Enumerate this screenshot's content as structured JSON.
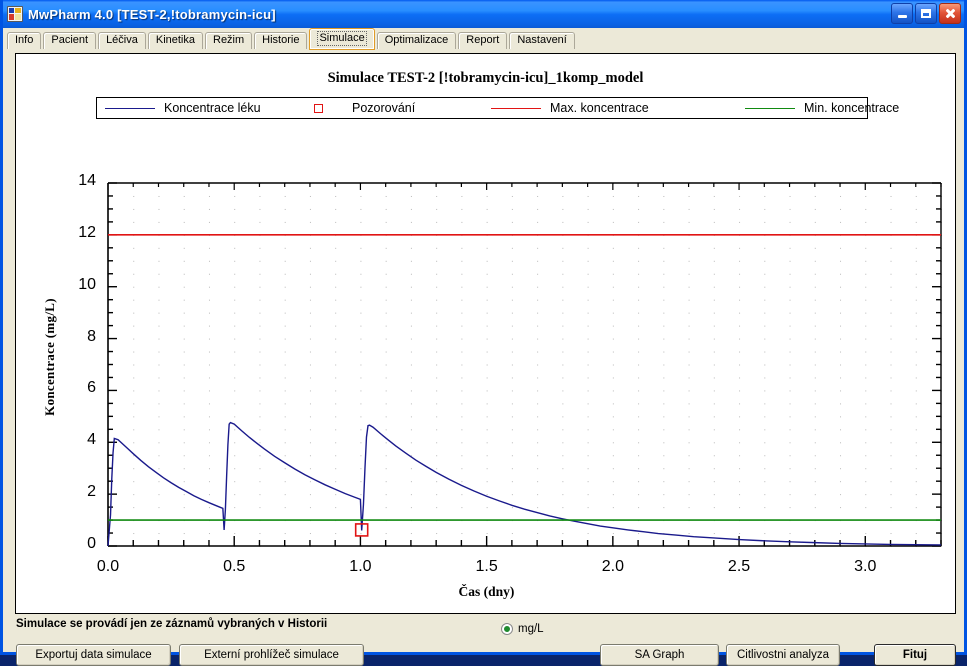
{
  "window": {
    "title": "MwPharm 4.0  [TEST-2,!tobramycin-icu]",
    "icon": "app-icon",
    "buttons": {
      "minimize": "minimize-button",
      "maximize": "maximize-button",
      "close": "close-button"
    }
  },
  "tabs": [
    {
      "label": "Info",
      "active": false
    },
    {
      "label": "Pacient",
      "active": false
    },
    {
      "label": "Léčiva",
      "active": false
    },
    {
      "label": "Kinetika",
      "active": false
    },
    {
      "label": "Režim",
      "active": false
    },
    {
      "label": "Historie",
      "active": false
    },
    {
      "label": "Simulace",
      "active": true
    },
    {
      "label": "Optimalizace",
      "active": false
    },
    {
      "label": "Report",
      "active": false
    },
    {
      "label": "Nastavení",
      "active": false
    }
  ],
  "footer": {
    "note": "Simulace se provádí jen ze záznamů vybraných v Historii",
    "unit_label": "mg/L",
    "buttons": {
      "export": "Exportuj data simulace",
      "external_viewer": "Externí prohlížeč simulace",
      "sa_graph": "SA Graph",
      "sensitivity": "Citlivostni analyza",
      "fit": "Fituj"
    }
  },
  "chart_data": {
    "type": "line",
    "title": "Simulace  TEST-2 [!tobramycin-icu]_1komp_model",
    "xlabel": "Čas (dny)",
    "ylabel": "Koncentrace  (mg/L)",
    "xlim": [
      0.0,
      3.3
    ],
    "ylim": [
      0,
      14
    ],
    "xticks": [
      0.0,
      0.5,
      1.0,
      1.5,
      2.0,
      2.5,
      3.0
    ],
    "xtick_labels": [
      "0.0",
      "0.5",
      "1.0",
      "1.5",
      "2.0",
      "2.5",
      "3.0"
    ],
    "yticks": [
      0,
      2,
      4,
      6,
      8,
      10,
      12,
      14
    ],
    "ytick_labels": [
      "0",
      "2",
      "4",
      "6",
      "8",
      "10",
      "12",
      "14"
    ],
    "x_minor_step": 0.1,
    "y_minor_step": 0.5,
    "grid": true,
    "legend_position": "top",
    "legend": [
      {
        "label": "Koncentrace léku",
        "color": "#1a1a8c",
        "marker": "line"
      },
      {
        "label": "Pozorování",
        "color": "#e11414",
        "marker": "square"
      },
      {
        "label": "Max. koncentrace",
        "color": "#e11414",
        "marker": "line"
      },
      {
        "label": "Min. koncentrace",
        "color": "#118a11",
        "marker": "line"
      }
    ],
    "series": [
      {
        "name": "Koncentrace léku",
        "color": "#1a1a8c",
        "type": "line",
        "points": [
          [
            0.0,
            0.0
          ],
          [
            0.01,
            1.2
          ],
          [
            0.015,
            2.6
          ],
          [
            0.02,
            3.6
          ],
          [
            0.025,
            4.15
          ],
          [
            0.04,
            4.1
          ],
          [
            0.06,
            3.92
          ],
          [
            0.08,
            3.74
          ],
          [
            0.1,
            3.56
          ],
          [
            0.13,
            3.3
          ],
          [
            0.16,
            3.06
          ],
          [
            0.19,
            2.84
          ],
          [
            0.22,
            2.63
          ],
          [
            0.25,
            2.44
          ],
          [
            0.28,
            2.26
          ],
          [
            0.31,
            2.1
          ],
          [
            0.34,
            1.94
          ],
          [
            0.37,
            1.8
          ],
          [
            0.4,
            1.67
          ],
          [
            0.43,
            1.55
          ],
          [
            0.455,
            1.45
          ],
          [
            0.46,
            0.62
          ],
          [
            0.465,
            1.4
          ],
          [
            0.47,
            2.7
          ],
          [
            0.475,
            3.9
          ],
          [
            0.48,
            4.7
          ],
          [
            0.485,
            4.76
          ],
          [
            0.5,
            4.7
          ],
          [
            0.53,
            4.44
          ],
          [
            0.56,
            4.19
          ],
          [
            0.59,
            3.96
          ],
          [
            0.62,
            3.74
          ],
          [
            0.66,
            3.46
          ],
          [
            0.7,
            3.21
          ],
          [
            0.74,
            2.97
          ],
          [
            0.78,
            2.75
          ],
          [
            0.82,
            2.55
          ],
          [
            0.86,
            2.36
          ],
          [
            0.9,
            2.19
          ],
          [
            0.94,
            2.02
          ],
          [
            0.975,
            1.89
          ],
          [
            1.0,
            1.8
          ],
          [
            1.005,
            0.6
          ],
          [
            1.012,
            1.6
          ],
          [
            1.018,
            3.0
          ],
          [
            1.024,
            4.2
          ],
          [
            1.03,
            4.64
          ],
          [
            1.036,
            4.66
          ],
          [
            1.05,
            4.58
          ],
          [
            1.08,
            4.33
          ],
          [
            1.11,
            4.09
          ],
          [
            1.14,
            3.86
          ],
          [
            1.18,
            3.58
          ],
          [
            1.22,
            3.31
          ],
          [
            1.26,
            3.07
          ],
          [
            1.3,
            2.84
          ],
          [
            1.35,
            2.58
          ],
          [
            1.4,
            2.34
          ],
          [
            1.45,
            2.12
          ],
          [
            1.5,
            1.92
          ],
          [
            1.55,
            1.74
          ],
          [
            1.6,
            1.57
          ],
          [
            1.65,
            1.42
          ],
          [
            1.7,
            1.29
          ],
          [
            1.75,
            1.16
          ],
          [
            1.8,
            1.05
          ],
          [
            1.85,
            0.95
          ],
          [
            1.9,
            0.86
          ],
          [
            1.95,
            0.77
          ],
          [
            2.0,
            0.7
          ],
          [
            2.06,
            0.62
          ],
          [
            2.12,
            0.55
          ],
          [
            2.18,
            0.48
          ],
          [
            2.25,
            0.42
          ],
          [
            2.32,
            0.36
          ],
          [
            2.4,
            0.31
          ],
          [
            2.5,
            0.25
          ],
          [
            2.6,
            0.2
          ],
          [
            2.7,
            0.16
          ],
          [
            2.8,
            0.13
          ],
          [
            2.9,
            0.1
          ],
          [
            3.0,
            0.08
          ],
          [
            3.1,
            0.06
          ],
          [
            3.2,
            0.05
          ],
          [
            3.3,
            0.04
          ]
        ]
      },
      {
        "name": "Max. koncentrace",
        "color": "#e11414",
        "type": "hline",
        "value": 12.0
      },
      {
        "name": "Min. koncentrace",
        "color": "#118a11",
        "type": "hline",
        "value": 1.0
      },
      {
        "name": "Pozorování",
        "color": "#e11414",
        "type": "scatter",
        "marker": "open-square",
        "points": [
          [
            1.005,
            0.62
          ]
        ]
      }
    ]
  }
}
